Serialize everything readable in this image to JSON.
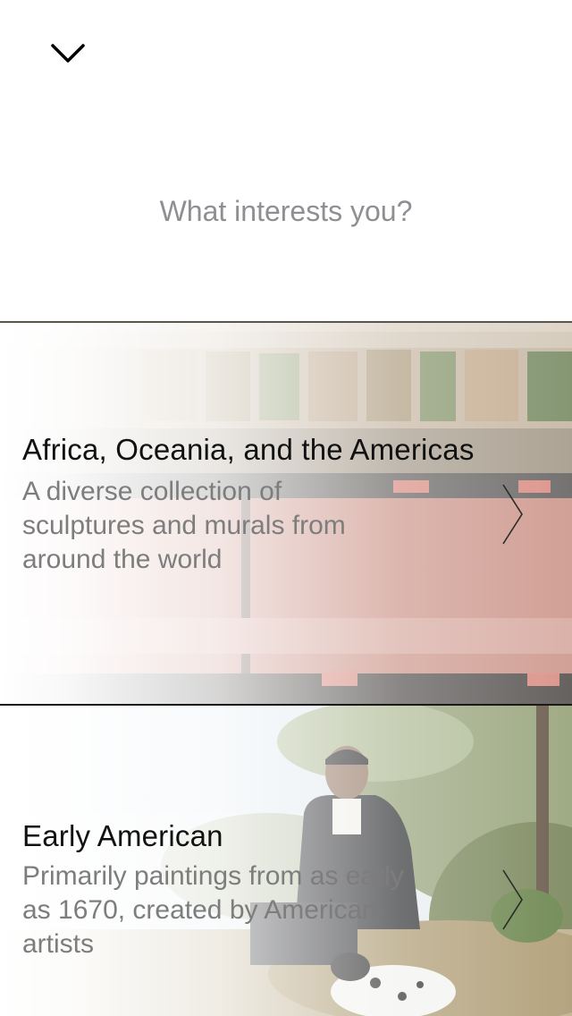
{
  "header": {
    "collapse_icon": "chevron-down-icon",
    "prompt": "What interests you?"
  },
  "categories": [
    {
      "title": "Africa, Oceania, and the Americas",
      "description": "A diverse collection of sculptures and murals from around the world",
      "chevron_icon": "chevron-right-icon",
      "artwork_colors": [
        "#c9b49f",
        "#b97b6e",
        "#6e7f57",
        "#d89c92",
        "#3f3f3f"
      ]
    },
    {
      "title": "Early American",
      "description": "Primarily paintings from as early as 1670, created by American artists",
      "chevron_icon": "chevron-right-icon",
      "artwork_colors": [
        "#a7b79b",
        "#6b7a4c",
        "#1d1e22",
        "#e9eef2",
        "#d8c3a6"
      ]
    }
  ],
  "colors": {
    "prompt_text": "#8e8e93",
    "title_text": "#111111",
    "description_text": "#7d7d7d",
    "divider": "#5a544c"
  }
}
